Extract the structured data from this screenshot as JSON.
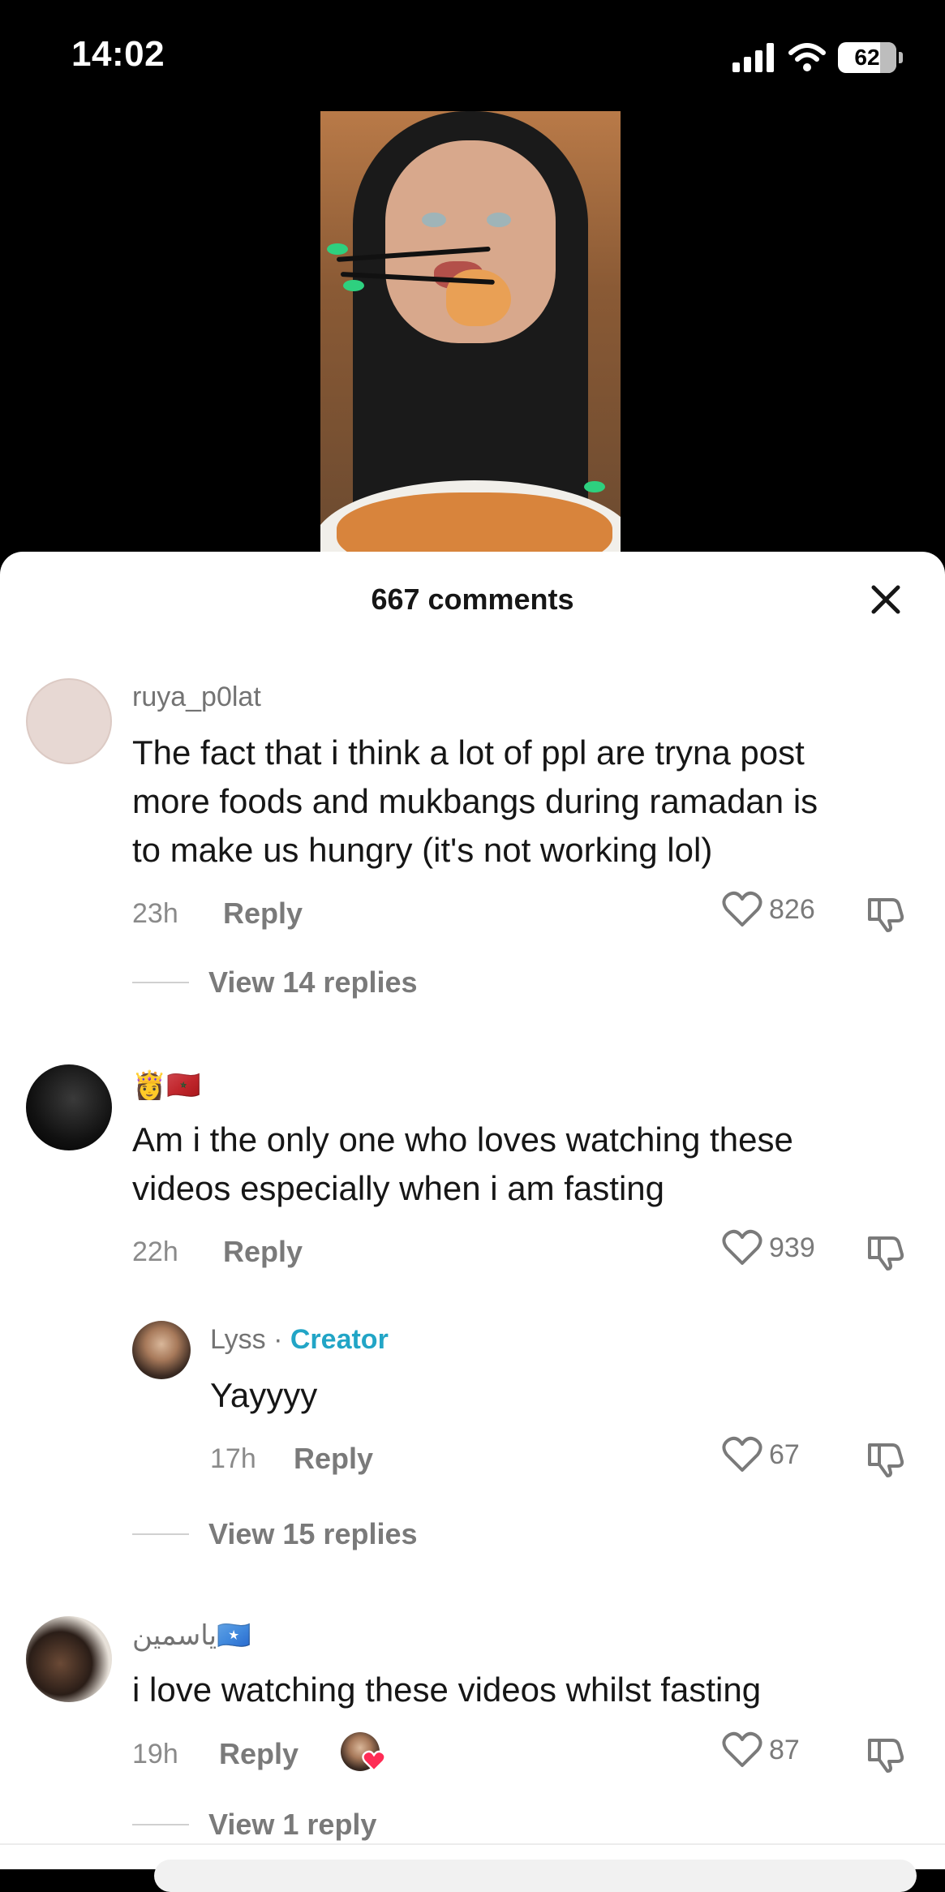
{
  "status": {
    "time": "14:02",
    "battery": "62"
  },
  "sheet": {
    "title": "667 comments"
  },
  "comments": [
    {
      "username": "ruya_p0lat",
      "text_lines": [
        "The fact that i think a lot of ppl are tryna post",
        "more foods and mukbangs during ramadan is",
        "to make us hungry (it's not working lol)"
      ],
      "time": "23h",
      "reply_label": "Reply",
      "likes": "826",
      "view_replies": "View 14 replies"
    },
    {
      "username": "👸🇲🇦",
      "text_lines": [
        "Am i the only one who loves watching these",
        "videos especially when i am fasting"
      ],
      "time": "22h",
      "reply_label": "Reply",
      "likes": "939",
      "view_replies": "View 15 replies",
      "reply": {
        "username": "Lyss",
        "separator": " · ",
        "badge": "Creator",
        "text": "Yayyyy",
        "time": "17h",
        "reply_label": "Reply",
        "likes": "67"
      }
    },
    {
      "username": "ياسمين🇸🇴",
      "text_lines": [
        "i love watching these videos whilst fasting"
      ],
      "time": "19h",
      "reply_label": "Reply",
      "likes": "87",
      "view_replies": "View 1 reply"
    }
  ],
  "icons": {
    "close": "close-icon",
    "heart": "heart-icon",
    "dislike": "thumbs-down-icon",
    "creator_liked": "creator-liked-heart-icon"
  },
  "colors": {
    "creator": "#22a5c6",
    "liked_heart": "#fe2c55"
  }
}
